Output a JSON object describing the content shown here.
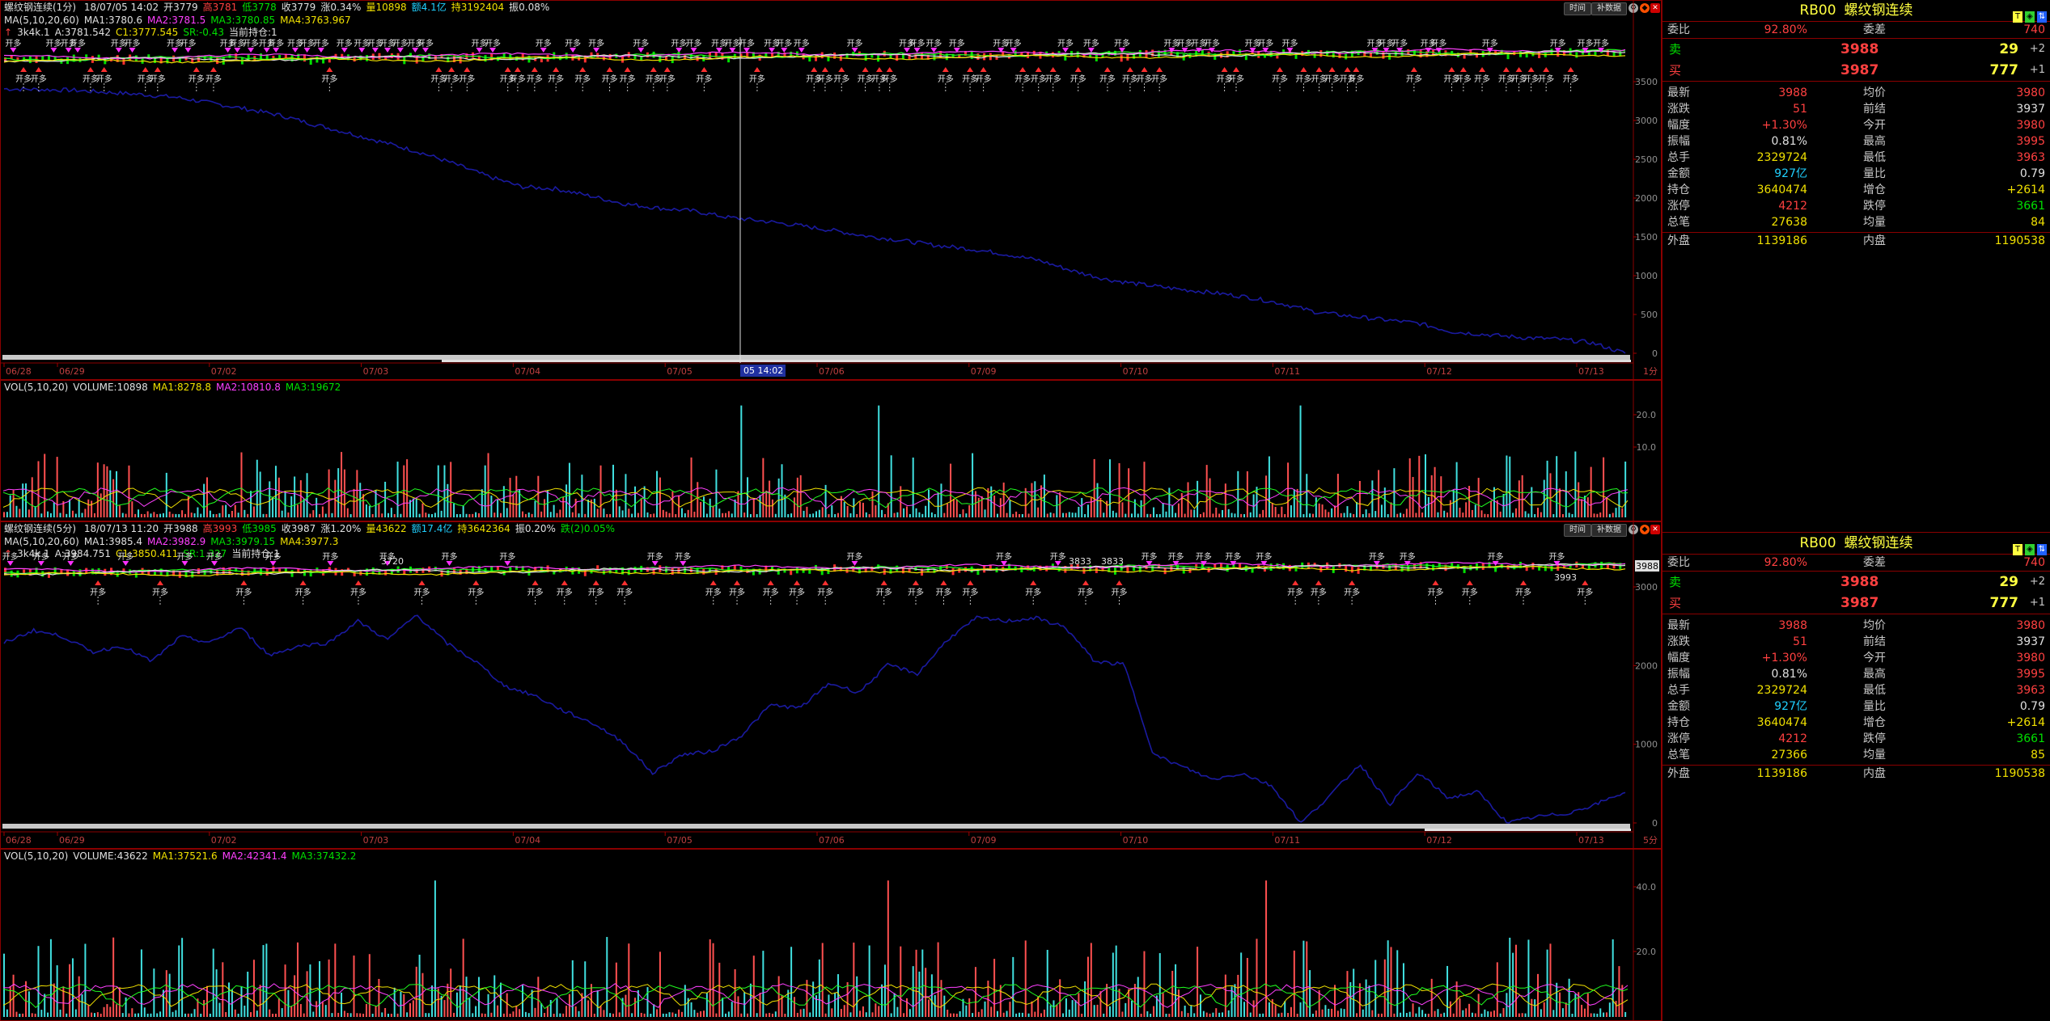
{
  "colors": {
    "up": "#ff3030",
    "down": "#00e000",
    "border": "#8a0000",
    "ma1": "#e0e0e0",
    "ma2": "#ff40ff",
    "ma3": "#20ff20",
    "ma4": "#f0e000",
    "equity": "#1a1aa0"
  },
  "top_chart": {
    "title": "螺纹钢连续(1分)",
    "fields": [
      {
        "t": "18/07/05 14:02",
        "c": "w"
      },
      {
        "t": "开3779",
        "c": "w"
      },
      {
        "t": "高3781",
        "c": "r"
      },
      {
        "t": "低3778",
        "c": "g"
      },
      {
        "t": "收3779",
        "c": "w"
      },
      {
        "t": "涨0.34%",
        "c": "w"
      },
      {
        "t": "量10898",
        "c": "y"
      },
      {
        "t": "额4.1亿",
        "c": "c"
      },
      {
        "t": "持3192404",
        "c": "y"
      },
      {
        "t": "振0.08%",
        "c": "w"
      }
    ],
    "ma_line": [
      {
        "t": "MA(5,10,20,60)",
        "c": "w"
      },
      {
        "t": "MA1:3780.6",
        "c": "w"
      },
      {
        "t": "MA2:3781.5",
        "c": "m"
      },
      {
        "t": "MA3:3780.85",
        "c": "g"
      },
      {
        "t": "MA4:3763.967",
        "c": "y"
      }
    ],
    "strategy_line": [
      {
        "t": "3k4k.1",
        "c": "w"
      },
      {
        "t": "A:3781.542",
        "c": "w"
      },
      {
        "t": "C1:3777.545",
        "c": "y"
      },
      {
        "t": "SR:-0.43",
        "c": "g"
      },
      {
        "t": "当前持仓:1",
        "c": "w"
      }
    ],
    "buttons": [
      "时间",
      "补数据"
    ],
    "y_ticks": [
      "3500",
      "3000",
      "2500",
      "2000",
      "1500",
      "1000",
      "500",
      "0"
    ],
    "x_ticks": [
      "06/28",
      "06/29",
      "07/02",
      "07/03",
      "07/04",
      "07/05",
      "07/06",
      "07/09",
      "07/10",
      "07/11",
      "07/12",
      "07/13"
    ],
    "cursor_label": "05 14:02",
    "period_label": "1分",
    "signal_text": "开多",
    "equity": [
      3700,
      3690,
      3680,
      3650,
      3620,
      3580,
      3500,
      3420,
      3330,
      3200,
      3080,
      2950,
      2820,
      2660,
      2480,
      2330,
      2300,
      2200,
      2090,
      2030,
      1990,
      1900,
      1850,
      1790,
      1720,
      1640,
      1580,
      1510,
      1460,
      1390,
      1300,
      1150,
      1030,
      960,
      900,
      850,
      790,
      700,
      580,
      520,
      470,
      420,
      300,
      260,
      220,
      200,
      150,
      0
    ]
  },
  "top_vol": {
    "label": "VOL(5,10,20)",
    "fields": [
      {
        "t": "VOLUME:10898",
        "c": "w"
      },
      {
        "t": "MA1:8278.8",
        "c": "y"
      },
      {
        "t": "MA2:10810.8",
        "c": "m"
      },
      {
        "t": "MA3:19672",
        "c": "g"
      }
    ],
    "y_ticks": [
      "20.0",
      "10.0"
    ]
  },
  "mid_chart": {
    "title": "螺纹钢连续(5分)",
    "fields": [
      {
        "t": "18/07/13 11:20",
        "c": "w"
      },
      {
        "t": "开3988",
        "c": "w"
      },
      {
        "t": "高3993",
        "c": "r"
      },
      {
        "t": "低3985",
        "c": "g"
      },
      {
        "t": "收3987",
        "c": "w"
      },
      {
        "t": "涨1.20%",
        "c": "w"
      },
      {
        "t": "量43622",
        "c": "y"
      },
      {
        "t": "额17.4亿",
        "c": "c"
      },
      {
        "t": "持3642364",
        "c": "y"
      },
      {
        "t": "振0.20%",
        "c": "w"
      },
      {
        "t": "跌(2)0.05%",
        "c": "g"
      }
    ],
    "ma_line": [
      {
        "t": "MA(5,10,20,60)",
        "c": "w"
      },
      {
        "t": "MA1:3985.4",
        "c": "w"
      },
      {
        "t": "MA2:3982.9",
        "c": "m"
      },
      {
        "t": "MA3:3979.15",
        "c": "g"
      },
      {
        "t": "MA4:3977.3",
        "c": "y"
      }
    ],
    "strategy_line": [
      {
        "t": "3k4k.1",
        "c": "w"
      },
      {
        "t": "A:3984.751",
        "c": "w"
      },
      {
        "t": "C1:3850.411",
        "c": "y"
      },
      {
        "t": "SR:1.327",
        "c": "g"
      },
      {
        "t": "当前持仓:1",
        "c": "w"
      }
    ],
    "buttons": [
      "时间",
      "补数据"
    ],
    "y_ticks": [
      "3000",
      "2000",
      "1000",
      "0"
    ],
    "x_ticks": [
      "06/28",
      "06/29",
      "07/02",
      "07/03",
      "07/04",
      "07/05",
      "07/06",
      "07/09",
      "07/10",
      "07/11",
      "07/12",
      "07/13"
    ],
    "price_labels": [
      "3720",
      "3833",
      "3833",
      "3993"
    ],
    "last_price": "3988",
    "period_label": "5分",
    "signal_text": "开多",
    "equity": [
      2900,
      3100,
      3000,
      2750,
      2850,
      2600,
      3000,
      2900,
      3150,
      2700,
      2850,
      2900,
      3250,
      2950,
      3350,
      2900,
      2600,
      2200,
      2050,
      1800,
      1600,
      1300,
      800,
      1100,
      1150,
      1400,
      1900,
      1850,
      2250,
      2100,
      2550,
      2400,
      2950,
      3300,
      3250,
      3300,
      3150,
      2600,
      2550,
      1100,
      900,
      700,
      800,
      600,
      0,
      450,
      950,
      300,
      800,
      400,
      500,
      0,
      100,
      150,
      300,
      500
    ]
  },
  "mid_vol": {
    "label": "VOL(5,10,20)",
    "fields": [
      {
        "t": "VOLUME:43622",
        "c": "w"
      },
      {
        "t": "MA1:37521.6",
        "c": "y"
      },
      {
        "t": "MA2:42341.4",
        "c": "m"
      },
      {
        "t": "MA3:37432.2",
        "c": "g"
      }
    ],
    "y_ticks": [
      "40.0",
      "20.0"
    ]
  },
  "quote_panels": [
    {
      "symbol": "RB00",
      "name": "螺纹钢连续",
      "weibi_label": "委比",
      "weibi": "92.80%",
      "weicha_label": "委差",
      "weicha": "740",
      "sell_label": "卖",
      "sell_price": "3988",
      "sell_vol": "29",
      "sell_chg": "+2",
      "buy_label": "买",
      "buy_price": "3987",
      "buy_vol": "777",
      "buy_chg": "+1",
      "rows": [
        {
          "l1": "最新",
          "v1": "3988",
          "c1": "r",
          "l2": "均价",
          "v2": "3980",
          "c2": "r"
        },
        {
          "l1": "涨跌",
          "v1": "51",
          "c1": "r",
          "l2": "前结",
          "v2": "3937",
          "c2": "w"
        },
        {
          "l1": "幅度",
          "v1": "+1.30%",
          "c1": "r",
          "l2": "今开",
          "v2": "3980",
          "c2": "r"
        },
        {
          "l1": "振幅",
          "v1": "0.81%",
          "c1": "w",
          "l2": "最高",
          "v2": "3995",
          "c2": "r"
        },
        {
          "l1": "总手",
          "v1": "2329724",
          "c1": "y",
          "l2": "最低",
          "v2": "3963",
          "c2": "r"
        },
        {
          "l1": "金额",
          "v1": "927亿",
          "c1": "c",
          "l2": "量比",
          "v2": "0.79",
          "c2": "w"
        },
        {
          "l1": "持仓",
          "v1": "3640474",
          "c1": "y",
          "l2": "增仓",
          "v2": "+2614",
          "c2": "y"
        },
        {
          "l1": "涨停",
          "v1": "4212",
          "c1": "r",
          "l2": "跌停",
          "v2": "3661",
          "c2": "g"
        },
        {
          "l1": "总笔",
          "v1": "27638",
          "c1": "y",
          "l2": "均量",
          "v2": "84",
          "c2": "y"
        }
      ],
      "waipan_label": "外盘",
      "waipan": "1139186",
      "neipan_label": "内盘",
      "neipan": "1190538"
    },
    {
      "symbol": "RB00",
      "name": "螺纹钢连续",
      "weibi_label": "委比",
      "weibi": "92.80%",
      "weicha_label": "委差",
      "weicha": "740",
      "sell_label": "卖",
      "sell_price": "3988",
      "sell_vol": "29",
      "sell_chg": "+2",
      "buy_label": "买",
      "buy_price": "3987",
      "buy_vol": "777",
      "buy_chg": "+1",
      "rows": [
        {
          "l1": "最新",
          "v1": "3988",
          "c1": "r",
          "l2": "均价",
          "v2": "3980",
          "c2": "r"
        },
        {
          "l1": "涨跌",
          "v1": "51",
          "c1": "r",
          "l2": "前结",
          "v2": "3937",
          "c2": "w"
        },
        {
          "l1": "幅度",
          "v1": "+1.30%",
          "c1": "r",
          "l2": "今开",
          "v2": "3980",
          "c2": "r"
        },
        {
          "l1": "振幅",
          "v1": "0.81%",
          "c1": "w",
          "l2": "最高",
          "v2": "3995",
          "c2": "r"
        },
        {
          "l1": "总手",
          "v1": "2329724",
          "c1": "y",
          "l2": "最低",
          "v2": "3963",
          "c2": "r"
        },
        {
          "l1": "金额",
          "v1": "927亿",
          "c1": "c",
          "l2": "量比",
          "v2": "0.79",
          "c2": "w"
        },
        {
          "l1": "持仓",
          "v1": "3640474",
          "c1": "y",
          "l2": "增仓",
          "v2": "+2614",
          "c2": "y"
        },
        {
          "l1": "涨停",
          "v1": "4212",
          "c1": "r",
          "l2": "跌停",
          "v2": "3661",
          "c2": "g"
        },
        {
          "l1": "总笔",
          "v1": "27366",
          "c1": "y",
          "l2": "均量",
          "v2": "85",
          "c2": "y"
        }
      ],
      "waipan_label": "外盘",
      "waipan": "1139186",
      "neipan_label": "内盘",
      "neipan": "1190538"
    }
  ]
}
